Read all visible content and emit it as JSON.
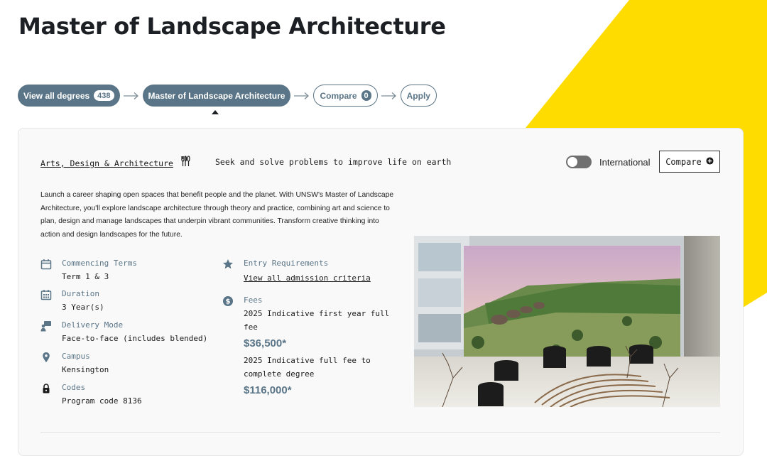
{
  "page": {
    "title": "Master of Landscape Architecture",
    "accent_color": "#5a7587",
    "brand_yellow": "#ffdc00"
  },
  "breadcrumb": {
    "view_all_label": "View all degrees",
    "view_all_count": "438",
    "current_label": "Master of Landscape Architecture",
    "compare_label": "Compare",
    "compare_count": "0",
    "apply_label": "Apply",
    "arrow_icon": "arrow-right-icon",
    "caret_icon": "caret-up-icon"
  },
  "card": {
    "faculty_link": "Arts, Design & Architecture",
    "faculty_icon": "utensils-icon",
    "slogan": "Seek and solve problems to improve life on earth",
    "international_label": "International",
    "international_toggle": "off",
    "compare_button": "Compare",
    "compare_icon": "plus-circle-icon",
    "description": "Launch a career shaping open spaces that benefit people and the planet. With UNSW's Master of Landscape Architecture, you'll explore landscape architecture through theory and practice, combining art and science to plan, design and manage landscapes that underpin vibrant communities. Transform creative thinking into action and design landscapes for the future."
  },
  "details": {
    "commencing": {
      "label": "Commencing Terms",
      "value": "Term 1 & 3",
      "icon": "calendar-icon"
    },
    "duration": {
      "label": "Duration",
      "value": "3 Year(s)",
      "icon": "calendar-grid-icon"
    },
    "delivery": {
      "label": "Delivery Mode",
      "value": "Face-to-face (includes blended)",
      "icon": "presenter-icon"
    },
    "campus": {
      "label": "Campus",
      "value": "Kensington",
      "icon": "map-pin-icon"
    },
    "codes": {
      "label": "Codes",
      "value": "Program code 8136",
      "icon": "lock-icon"
    },
    "entry": {
      "label": "Entry Requirements",
      "link": "View all admission criteria",
      "icon": "star-icon"
    },
    "fees": {
      "label": "Fees",
      "icon": "dollar-circle-icon",
      "first_year_desc": "2025 Indicative first year full fee",
      "first_year_amount": "$36,500*",
      "full_desc": "2025 Indicative full fee to complete degree",
      "full_amount": "$116,000*"
    }
  },
  "image": {
    "subject": "landscape-architecture-model-photo"
  }
}
